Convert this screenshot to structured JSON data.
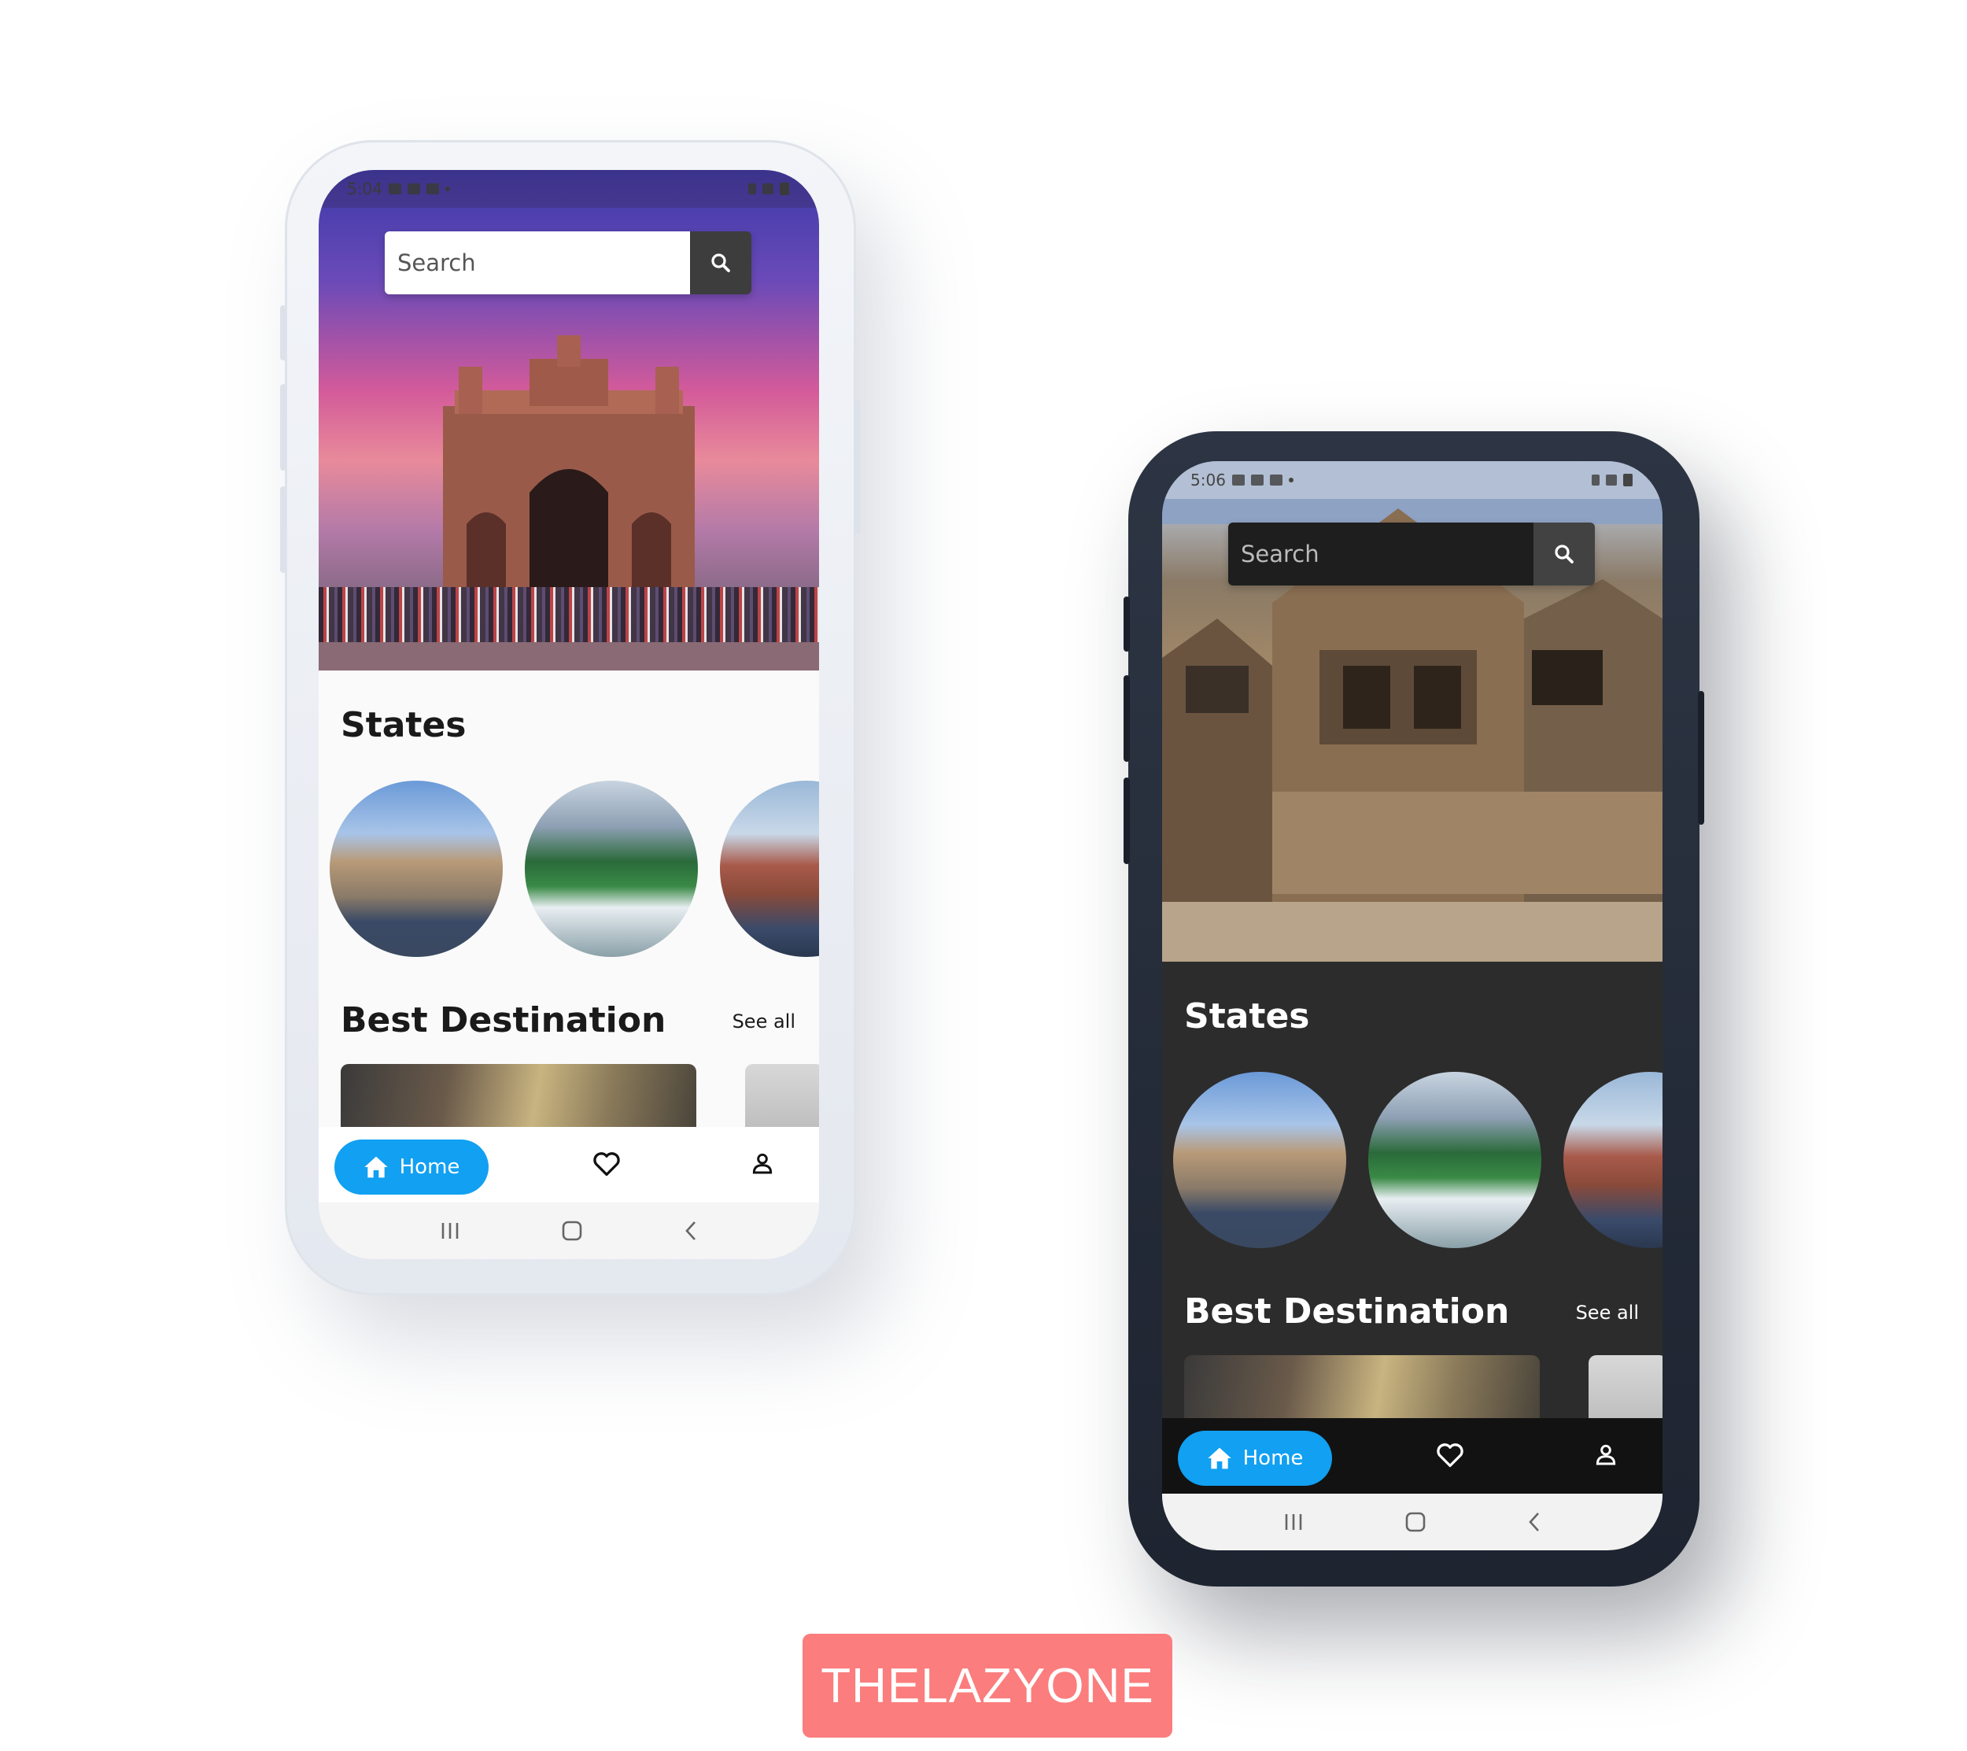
{
  "brand": {
    "label": "THELAZYONE",
    "color": "#fb7d7d"
  },
  "phones": [
    {
      "theme": "light",
      "status_time": "5:04",
      "search": {
        "placeholder": "Search"
      },
      "sections": {
        "states_title": "States",
        "best_title": "Best Destination",
        "see_all": "See all"
      },
      "nav": {
        "home_label": "Home",
        "favorites_icon": "heart-icon",
        "profile_icon": "person-icon"
      },
      "accent": "#11a0f2"
    },
    {
      "theme": "dark",
      "status_time": "5:06",
      "search": {
        "placeholder": "Search"
      },
      "sections": {
        "states_title": "States",
        "best_title": "Best Destination",
        "see_all": "See all"
      },
      "nav": {
        "home_label": "Home",
        "favorites_icon": "heart-icon",
        "profile_icon": "person-icon"
      },
      "accent": "#11a0f2"
    }
  ]
}
